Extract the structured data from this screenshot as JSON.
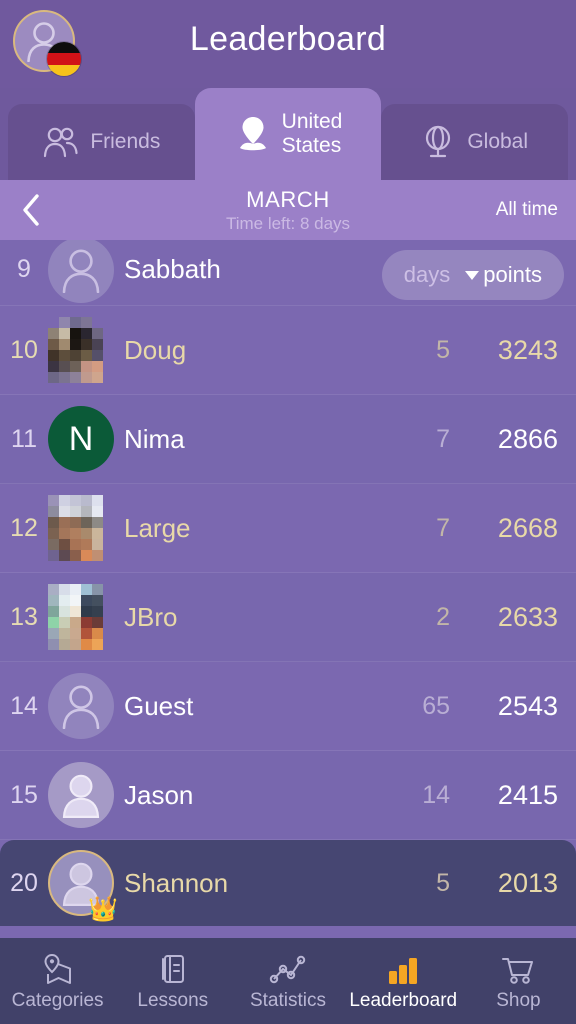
{
  "header": {
    "title": "Leaderboard",
    "avatar_icon": "person-silhouette-icon",
    "flag_badge": "german-flag-icon"
  },
  "tabs": [
    {
      "id": "friends",
      "label": "Friends",
      "icon": "people-group-icon",
      "active": false
    },
    {
      "id": "united-states",
      "label": "United\nStates",
      "label_line1": "United",
      "label_line2": "States",
      "icon": "map-pin-icon",
      "active": true
    },
    {
      "id": "global",
      "label": "Global",
      "icon": "globe-icon",
      "active": false
    }
  ],
  "subheader": {
    "back_icon": "chevron-left-icon",
    "period": "MARCH",
    "time_left": "Time left: 8 days",
    "all_time": "All time"
  },
  "sort": {
    "days_label": "days",
    "points_label": "points",
    "caret_icon": "caret-down-icon",
    "active": "points",
    "direction": "descending"
  },
  "colors": {
    "header_bg": "#70599E",
    "tab_active_bg": "#9B80C8",
    "tab_inactive_bg": "#66508F",
    "list_bg": "#7B68B0",
    "highlight_row_bg": "#464672",
    "nav_bg": "#414169",
    "gold_text": "#E8D9A8",
    "accent_orange": "#F5A623",
    "avatar_ring_gold": "#D9B97F",
    "letter_avatar_green": "#0B5A38"
  },
  "rows": [
    {
      "rank": "9",
      "name": "Sabbath",
      "days": "",
      "points": "",
      "avatar": "default-silhouette",
      "style": "white",
      "values_hidden": true
    },
    {
      "rank": "10",
      "name": "Doug",
      "days": "5",
      "points": "3243",
      "avatar": "pixelated-photo",
      "style": "gold"
    },
    {
      "rank": "11",
      "name": "Nima",
      "days": "7",
      "points": "2866",
      "avatar": "letter",
      "avatar_letter": "N",
      "style": "white"
    },
    {
      "rank": "12",
      "name": "Large",
      "days": "7",
      "points": "2668",
      "avatar": "pixelated-photo",
      "style": "gold"
    },
    {
      "rank": "13",
      "name": "JBro",
      "days": "2",
      "points": "2633",
      "avatar": "pixelated-photo",
      "style": "gold"
    },
    {
      "rank": "14",
      "name": "Guest",
      "days": "65",
      "points": "2543",
      "avatar": "default-silhouette",
      "style": "white"
    },
    {
      "rank": "15",
      "name": "Jason",
      "days": "14",
      "points": "2415",
      "avatar": "default-silhouette",
      "style": "white"
    },
    {
      "rank": "20",
      "name": "Shannon",
      "days": "5",
      "points": "2013",
      "avatar": "default-silhouette-ringed",
      "badge": "crown-icon",
      "style": "gold",
      "highlight": true
    }
  ],
  "bottom_nav": [
    {
      "id": "categories",
      "label": "Categories",
      "icon": "map-pin-map-icon",
      "active": false
    },
    {
      "id": "lessons",
      "label": "Lessons",
      "icon": "book-icon",
      "active": false
    },
    {
      "id": "statistics",
      "label": "Statistics",
      "icon": "line-chart-icon",
      "active": false
    },
    {
      "id": "leaderboard",
      "label": "Leaderboard",
      "icon": "bar-chart-icon",
      "active": true
    },
    {
      "id": "shop",
      "label": "Shop",
      "icon": "shopping-cart-icon",
      "active": false
    }
  ]
}
